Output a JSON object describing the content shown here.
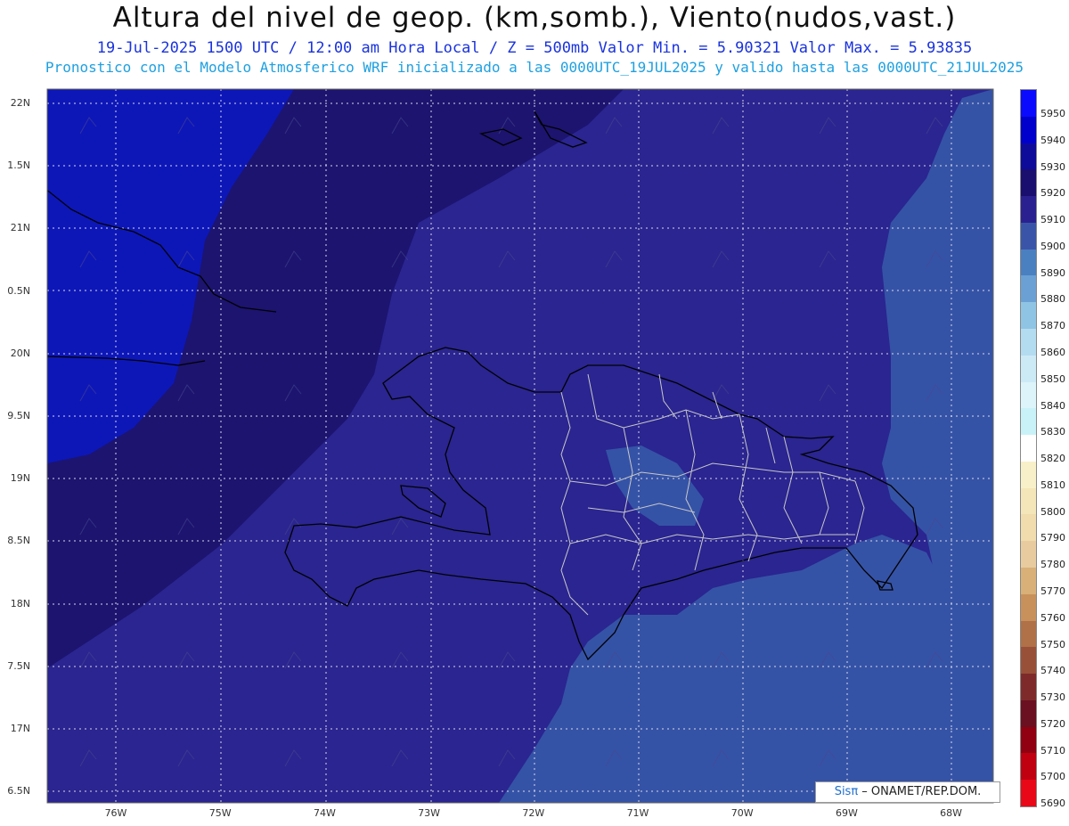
{
  "title": {
    "line1": "Altura del nivel de geop. (km,somb.), Viento(nudos,vast.)",
    "line2": "19-Jul-2025  1500 UTC / 12:00 am Hora Local / Z = 500mb    Valor Min. = 5.90321  Valor Max. = 5.93835",
    "line3": "Pronostico con el Modelo Atmosferico WRF inicializado a las 0000UTC_19JUL2025 y valido hasta las  0000UTC_21JUL2025"
  },
  "axes": {
    "latitude_labels": [
      "22N",
      "1.5N",
      "21N",
      "0.5N",
      "20N",
      "9.5N",
      "19N",
      "8.5N",
      "18N",
      "7.5N",
      "17N",
      "6.5N"
    ],
    "longitude_labels": [
      "76W",
      "75W",
      "74W",
      "73W",
      "72W",
      "71W",
      "70W",
      "69W",
      "68W"
    ]
  },
  "colorbar": {
    "levels": [
      "5950",
      "5940",
      "5930",
      "5920",
      "5910",
      "5900",
      "5890",
      "5880",
      "5870",
      "5860",
      "5850",
      "5840",
      "5830",
      "5820",
      "5810",
      "5800",
      "5790",
      "5780",
      "5770",
      "5760",
      "5750",
      "5740",
      "5730",
      "5720",
      "5710",
      "5700",
      "5690"
    ],
    "colors": [
      "#0a0aff",
      "#0000cc",
      "#0e0a9a",
      "#1a0e6e",
      "#2a2090",
      "#3a55a8",
      "#4a7fc0",
      "#6aa0d4",
      "#90c4e4",
      "#b4dcf0",
      "#cceaf6",
      "#ddf4fa",
      "#c8f2f8",
      "#ffffff",
      "#f8f0c8",
      "#f4e6b8",
      "#f0dcac",
      "#e8cca0",
      "#d8b078",
      "#c8905a",
      "#b07048",
      "#985038",
      "#7e2a2a",
      "#6a1020",
      "#900010",
      "#c00010",
      "#e80818"
    ]
  },
  "credit": {
    "brand": "Sisπ",
    "org": " – ONAMET/REP.DOM."
  },
  "colors": {
    "blue_region": "#0d17b8",
    "dark_band": "#1c146f",
    "mid_band": "#2a2590",
    "lighter_band": "#3553a6",
    "coastline": "#000000",
    "provinces": "#c8c8c8"
  }
}
